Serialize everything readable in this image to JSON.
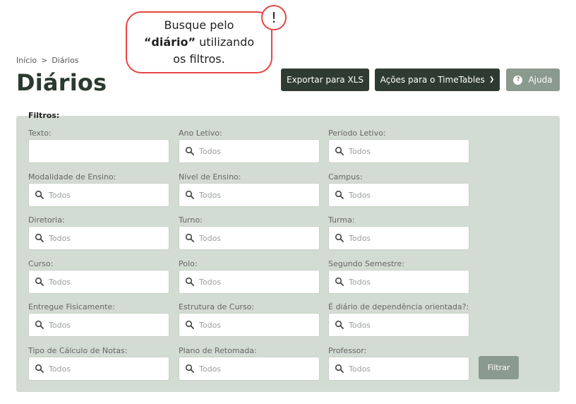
{
  "callout": {
    "line1": "Busque pelo",
    "bold": "“diário”",
    "line2_rest": " utilizando",
    "line3": "os filtros.",
    "mark": "!"
  },
  "breadcrumb": {
    "home": "Início",
    "separator": ">",
    "current": "Diários"
  },
  "page_title": "Diários",
  "toolbar": {
    "export_label": "Exportar para XLS",
    "actions_label": "Ações para o TimeTables",
    "help_label": "Ajuda"
  },
  "filters": {
    "title": "Filtros:",
    "placeholder": "Todos",
    "fields": [
      {
        "label": "Texto:",
        "search": false
      },
      {
        "label": "Ano Letivo:",
        "search": true
      },
      {
        "label": "Período Letivo:",
        "search": true
      },
      {
        "label": "Modalidade de Ensino:",
        "search": true
      },
      {
        "label": "Nível de Ensino:",
        "search": true
      },
      {
        "label": "Campus:",
        "search": true
      },
      {
        "label": "Diretoria:",
        "search": true
      },
      {
        "label": "Turno:",
        "search": true
      },
      {
        "label": "Turma:",
        "search": true
      },
      {
        "label": "Curso:",
        "search": true
      },
      {
        "label": "Polo:",
        "search": true
      },
      {
        "label": "Segundo Semestre:",
        "search": true
      },
      {
        "label": "Entregue Fisicamente:",
        "search": true
      },
      {
        "label": "Estrutura de Curso:",
        "search": true
      },
      {
        "label": "É diário de dependência orientada?:",
        "search": true
      },
      {
        "label": "Tipo de Cálculo de Notas:",
        "search": true
      },
      {
        "label": "Plano de Retomada:",
        "search": true
      },
      {
        "label": "Professor:",
        "search": true
      }
    ],
    "submit_label": "Filtrar"
  },
  "colors": {
    "dark_button": "#2f3b32",
    "muted_button": "#8a9a8c",
    "panel": "#d3dcd2",
    "callout_border": "#e64545"
  },
  "icons": {
    "search": "search-icon",
    "help": "question-circle-icon",
    "dropdown": "chevron-down-icon"
  }
}
